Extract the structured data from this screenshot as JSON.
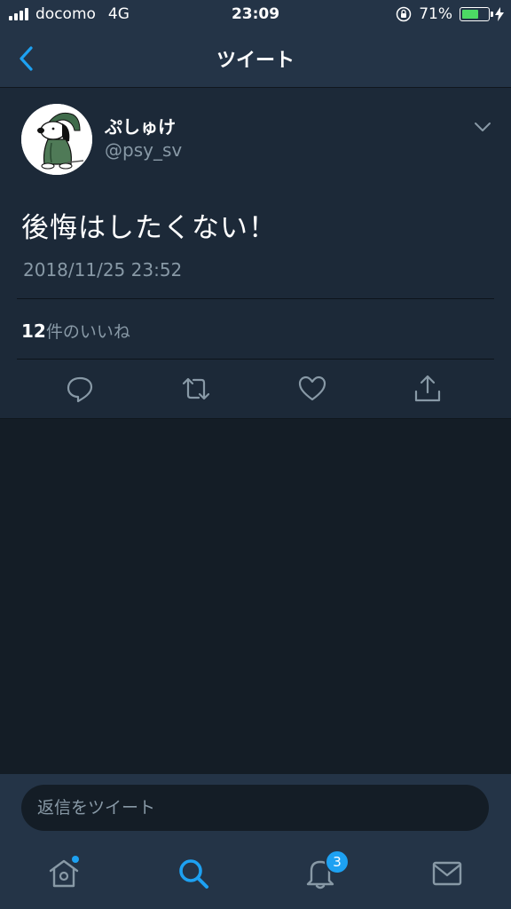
{
  "status": {
    "carrier": "docomo",
    "network": "4G",
    "time": "23:09",
    "battery_percent": "71%",
    "battery_level": 0.71
  },
  "nav": {
    "title": "ツイート",
    "back_icon": "chevron-left-icon"
  },
  "tweet": {
    "display_name": "ぷしゅけ",
    "handle": "@psy_sv",
    "text": "後悔はしたくない！",
    "timestamp": "2018/11/25 23:52",
    "likes_count": "12",
    "likes_label": "件のいいね"
  },
  "reply": {
    "placeholder": "返信をツイート"
  },
  "tabs": {
    "notifications_badge": "3"
  },
  "colors": {
    "accent": "#1da1f2",
    "background": "#141d26",
    "card": "#1c2938",
    "bar": "#243447",
    "secondary_text": "#8899a6"
  }
}
